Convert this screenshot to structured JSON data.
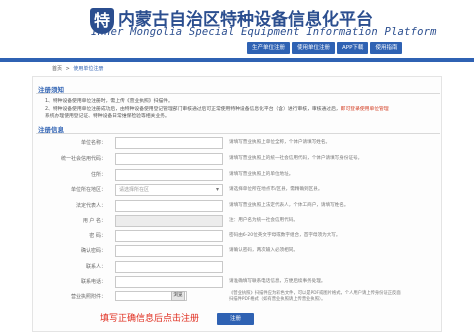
{
  "header": {
    "logo_glyph": "特",
    "title": "内蒙古自治区特种设备信息化平台",
    "subtitle": "Inner Mongolia Special Equipment Information Platform",
    "nav": [
      {
        "label": "生产单位注册"
      },
      {
        "label": "使用单位注册"
      },
      {
        "label": "APP下载"
      },
      {
        "label": "使用指南"
      }
    ]
  },
  "breadcrumb": {
    "home": "首页",
    "separator": ">",
    "current": "使用单位注册"
  },
  "notice": {
    "title": "注册须知",
    "lines": [
      {
        "text": "1、特种设备使用单位注册时，需上传《营业执照》扫描件。",
        "warn": ""
      },
      {
        "text": "2、特种设备使用单位注册成功后，由特种设备使用登记管理部门审核通过后可正常使用特种设备信息化平台（含）进行审核，审核通过后，",
        "warn": "即可登录使用单位管理"
      },
      {
        "text": "系统办理使用登记证、特种设备日常维保检验等相关业务。",
        "warn": ""
      }
    ]
  },
  "form": {
    "title": "注册信息",
    "rows": [
      {
        "label": "单位名称：",
        "value": "",
        "hint": "请填写营业执照上单位全称，个体户请填写姓名。",
        "required": true
      },
      {
        "label": "统一社会信用代码：",
        "value": "",
        "hint": "请填写营业执照上的统一社会信用代码，个体户请填写身份证号。",
        "required": true
      },
      {
        "label": "住所：",
        "value": "",
        "hint": "请填写营业执照上的单位地址。",
        "required": true
      },
      {
        "label": "单位所在地区：",
        "value": "请选择所在区",
        "hint": "请选择单位所在地点市/区县，需精确到区县。",
        "required": true,
        "select": true
      },
      {
        "label": "法定代表人：",
        "value": "",
        "hint": "请填写营业执照上法定代表人，个体工商户，请填写姓名。",
        "required": true
      },
      {
        "label": "用 户 名：",
        "value": "",
        "hint": "注：用户名为统一社会信用代码。",
        "required": false,
        "disabled": true
      },
      {
        "label": "密 码：",
        "value": "",
        "hint": "密码由6-20位英文字母或数字组合，首字母须为大写。",
        "required": true
      },
      {
        "label": "确认密码：",
        "value": "",
        "hint": "请确认密码，两次输入必须相同。",
        "required": true
      },
      {
        "label": "联系人：",
        "value": "",
        "hint": "",
        "required": true
      },
      {
        "label": "联系电话：",
        "value": "",
        "hint": "请准确填写联系电话信息，方便后续事务处理。",
        "required": true
      },
      {
        "label": "营业执照附件：",
        "value": "",
        "hint": "《营业执照》扫描件应为彩色文件，可以是PDF或图片格式，个人用户请上传身份证正反面扫描件PDF格式（如有营业执照请上传营业执照）。",
        "required": false,
        "file": true,
        "browse_label": "浏览"
      }
    ],
    "submit_label": "注册"
  },
  "annotation": "填写正确信息后点击注册",
  "colors": {
    "brand_blue": "#2f62b3",
    "annotation_red": "#e02a1c"
  }
}
